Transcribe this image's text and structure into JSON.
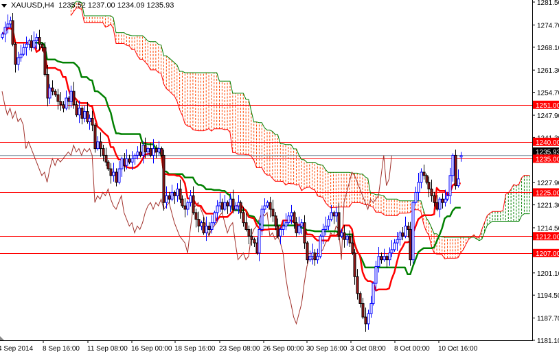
{
  "header": {
    "symbol": "XAUUSD,H4",
    "ohlc": "1235.52 1237.00 1234.09 1235.93"
  },
  "colors": {
    "bull_candle": "#0000ff",
    "bear_candle_fill": "#a01818",
    "tenkan": "#ff0000",
    "kijun": "#008000",
    "span_a": "#ff0000",
    "span_b": "#008000",
    "chikou": "#a0302a",
    "level_line": "#ff0000",
    "bid_line": "#778899"
  },
  "chart_data": {
    "type": "candlestick",
    "title": "XAUUSD,H4",
    "timeframe": "H4",
    "ylim": [
      1181.1,
      1281.5
    ],
    "y_ticks": [
      "1281.50",
      "1274.70",
      "1268.10",
      "1261.30",
      "1254.70",
      "1247.90",
      "1241.30",
      "1227.90",
      "1221.30",
      "1214.50",
      "1201.10",
      "1194.50",
      "1187.70",
      "1181.10"
    ],
    "x_ticks": [
      "4 Sep 2014",
      "8 Sep 16:00",
      "11 Sep 08:00",
      "16 Sep 00:00",
      "18 Sep 16:00",
      "23 Sep 08:00",
      "26 Sep 00:00",
      "30 Sep 16:00",
      "3 Oct 08:00",
      "8 Oct 00:00",
      "10 Oct 16:00"
    ],
    "closes": [
      1272,
      1274,
      1275,
      1276,
      1269,
      1263,
      1265,
      1266,
      1268,
      1269,
      1270,
      1268,
      1270,
      1271,
      1269,
      1268,
      1260,
      1253,
      1256,
      1255,
      1254,
      1252,
      1251,
      1250,
      1253,
      1252,
      1255,
      1251,
      1248,
      1250,
      1247,
      1249,
      1246,
      1247,
      1245,
      1238,
      1240,
      1238,
      1236,
      1234,
      1232,
      1230,
      1231,
      1228,
      1232,
      1235,
      1233,
      1235,
      1234,
      1235,
      1236,
      1237,
      1236,
      1239,
      1237,
      1238,
      1236,
      1238,
      1237,
      1238,
      1236,
      1222,
      1224,
      1223,
      1225,
      1224,
      1226,
      1223,
      1221,
      1220,
      1222,
      1224,
      1219,
      1217,
      1215,
      1216,
      1213,
      1215,
      1214,
      1216,
      1219,
      1221,
      1222,
      1220,
      1222,
      1221,
      1223,
      1220,
      1221,
      1222,
      1219,
      1216,
      1214,
      1212,
      1211,
      1210,
      1207,
      1214,
      1220,
      1221,
      1222,
      1220,
      1218,
      1215,
      1212,
      1214,
      1215,
      1216,
      1218,
      1219,
      1216,
      1213,
      1215,
      1216,
      1210,
      1205,
      1206,
      1207,
      1205,
      1206,
      1212,
      1214,
      1215,
      1217,
      1219,
      1218,
      1219,
      1212,
      1213,
      1211,
      1212,
      1210,
      1207,
      1200,
      1195,
      1192,
      1188,
      1186,
      1189,
      1192,
      1198,
      1203,
      1206,
      1205,
      1206,
      1205,
      1207,
      1208,
      1210,
      1211,
      1213,
      1212,
      1215,
      1214,
      1205,
      1222,
      1225,
      1228,
      1231,
      1230,
      1228,
      1226,
      1224,
      1222,
      1220,
      1223,
      1222,
      1223,
      1224,
      1230,
      1236,
      1227,
      1229,
      1235.93
    ],
    "last_bar": {
      "open": 1235.52,
      "high": 1237.0,
      "low": 1234.09,
      "close": 1235.93
    },
    "indicator": {
      "name": "Ichimoku Kinko Hyo",
      "tenkan": 9,
      "kijun": 26,
      "senkou_b": 52
    },
    "levels": [
      {
        "price": 1251.0,
        "label": "1251.00"
      },
      {
        "price": 1240.0,
        "label": "1240.00"
      },
      {
        "price": 1235.0,
        "label": "1235.00"
      },
      {
        "price": 1225.0,
        "label": "1225.00"
      },
      {
        "price": 1212.0,
        "label": "1212.00"
      },
      {
        "price": 1207.0,
        "label": "1207.00"
      }
    ],
    "bid": {
      "price": 1235.93,
      "label": "1235.93"
    }
  }
}
